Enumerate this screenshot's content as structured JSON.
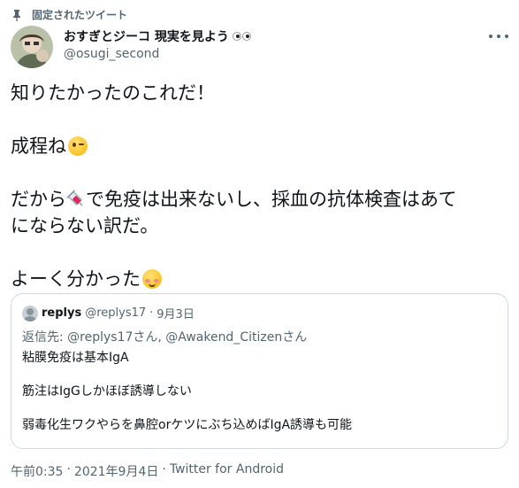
{
  "pinned": {
    "label": "固定されたツイート",
    "icon": "pin-icon"
  },
  "author": {
    "display_name": "おすぎとジーコ 現実を見よう",
    "handle": "@osugi_second"
  },
  "tweet": {
    "line1": "知りたかったのこれだ！",
    "line2": "成程ね",
    "line3a": "だから",
    "line3b": "で免疫は出来ないし、採血の抗体検査はあて",
    "line3c": "にならない訳だ。",
    "line4": "よーく分かった"
  },
  "quoted": {
    "name": "replys",
    "handle": "@replys17",
    "separator": "·",
    "date": "9月3日",
    "reply_prefix": "返信先: ",
    "reply_to": "@replys17さん, @Awakend_Citizenさん",
    "lines": [
      "粘膜免疫は基本IgA",
      "筋注はIgGしかほぼ誘導しない",
      "弱毒化生ワクやらを鼻腔orケツにぶち込めばIgA誘導も可能"
    ]
  },
  "footer": {
    "time": "午前0:35",
    "sep1": "·",
    "date": "2021年9月4日",
    "sep2": "·",
    "source": "Twitter for Android"
  },
  "colors": {
    "text": "#0f1419",
    "muted": "#536471",
    "border": "#cfd9de"
  }
}
